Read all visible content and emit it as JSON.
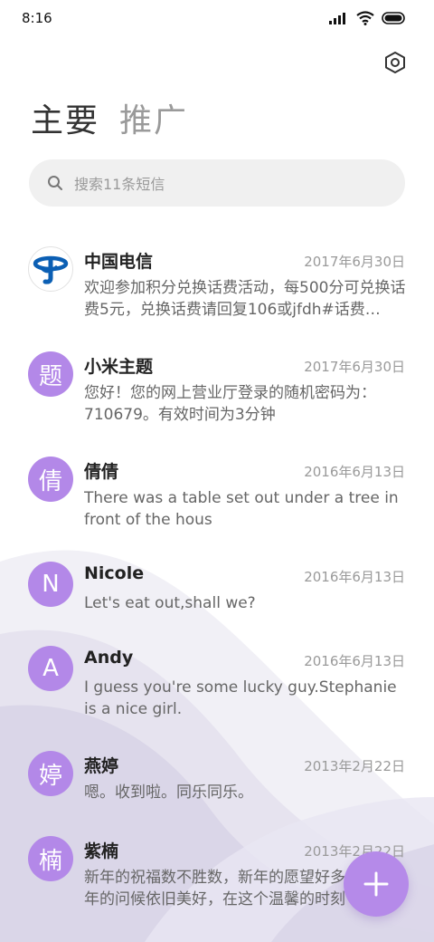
{
  "status_bar": {
    "time": "8:16"
  },
  "tabs": [
    {
      "label": "主要",
      "active": true
    },
    {
      "label": "推广",
      "active": false
    }
  ],
  "search": {
    "placeholder": "搜索11条短信"
  },
  "conversations": [
    {
      "avatar_text": "",
      "avatar_icon": "china-telecom-logo",
      "name": "中国电信",
      "date": "2017年6月30日",
      "message": "欢迎参加积分兑换话费活动，每500分可兑换话费5元，兑换话费请回复106或jfdh#话费…"
    },
    {
      "avatar_text": "题",
      "name": "小米主题",
      "date": "2017年6月30日",
      "message": "您好！您的网上营业厅登录的随机密码为：710679。有效时间为3分钟"
    },
    {
      "avatar_text": "倩",
      "name": "倩倩",
      "date": "2016年6月13日",
      "message": "There was a table set out under a tree in front of the hous"
    },
    {
      "avatar_text": "N",
      "name": "Nicole",
      "date": "2016年6月13日",
      "message": "Let's eat out,shall we?"
    },
    {
      "avatar_text": "A",
      "name": "Andy",
      "date": "2016年6月13日",
      "message": "I guess you're some lucky guy.Stephanie is a nice girl."
    },
    {
      "avatar_text": "婷",
      "name": "燕婷",
      "date": "2013年2月22日",
      "message": "嗯。收到啦。同乐同乐。"
    },
    {
      "avatar_text": "楠",
      "name": "紫楠",
      "date": "2013年2月22日",
      "message": "新年的祝福数不胜数，新年的愿望好多好多，新年的问候依旧美好，在这个温馨的时刻"
    }
  ],
  "colors": {
    "accent": "#b58ae9",
    "avatar": "#b388e8",
    "telecom_blue": "#0b5fb4"
  },
  "icons": {
    "settings": "gear-hexagon-icon",
    "search": "search-icon",
    "fab": "plus-icon",
    "signal": "signal-icon",
    "wifi": "wifi-icon",
    "battery": "battery-icon"
  }
}
